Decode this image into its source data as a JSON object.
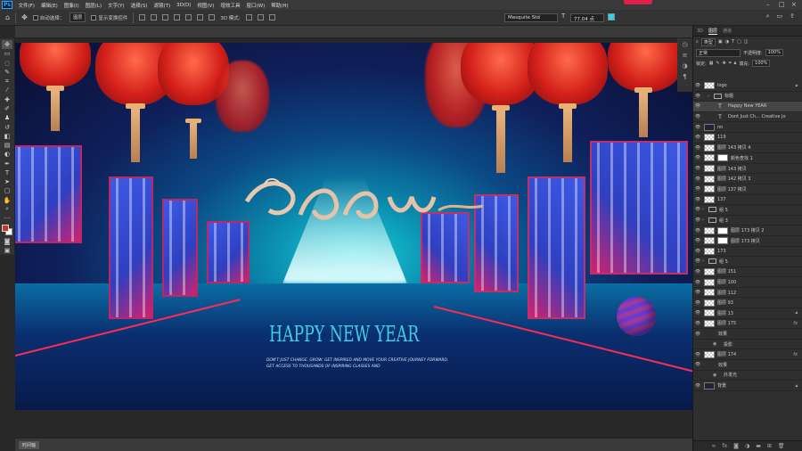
{
  "menubar": {
    "items": [
      "文件(F)",
      "编辑(E)",
      "图像(I)",
      "图层(L)",
      "文字(Y)",
      "选择(S)",
      "滤镜(T)",
      "3D(D)",
      "视图(V)",
      "增效工具",
      "窗口(W)",
      "帮助(H)"
    ],
    "logo": "Ps"
  },
  "options": {
    "auto_select_label": "自动选择：",
    "auto_select_value": "图层",
    "show_transform_label": "显示变换控件",
    "mode_label": "3D 模式:",
    "font": "Mesquite Std",
    "size": "77.04 点",
    "text_color": "#2ad4e0"
  },
  "canvas": {
    "headline": "HAPPY NEW YEAR",
    "subtitle_line1": "DON'T JUST CHANGE. GROW. GET INSPIRED AND MOVE YOUR CREATIVE JOURNEY FORWARD.",
    "subtitle_line2": "GET ACCESS TO THOUSANDS OF INSPIRING CLASSES AND"
  },
  "panels": {
    "tabs": [
      "3D",
      "图层",
      "通道"
    ],
    "kind_label": "类型",
    "blend_mode": "正常",
    "opacity_label": "不透明度:",
    "opacity": "100%",
    "lock_label": "锁定:",
    "fill_label": "填充:",
    "fill": "100%"
  },
  "layers": [
    {
      "name": "logo",
      "type": "img",
      "lock": true
    },
    {
      "name": "标题",
      "type": "group",
      "indent": 1
    },
    {
      "name": "Happy New YEAR",
      "type": "text",
      "indent": 2,
      "selected": true
    },
    {
      "name": "Dont Just Ch... Creative Jo",
      "type": "text",
      "indent": 2
    },
    {
      "name": "nn",
      "type": "dark"
    },
    {
      "name": "119",
      "type": "img"
    },
    {
      "name": "图层 143 拷贝 4",
      "type": "img"
    },
    {
      "name": "颜色查找 1",
      "type": "adj"
    },
    {
      "name": "图层 143 拷贝",
      "type": "img"
    },
    {
      "name": "图层 142 拷贝 3",
      "type": "img"
    },
    {
      "name": "图层 137 拷贝",
      "type": "img"
    },
    {
      "name": "137",
      "type": "img"
    },
    {
      "name": "组 5",
      "type": "group"
    },
    {
      "name": "组 3",
      "type": "group"
    },
    {
      "name": "图层 173 拷贝 2",
      "type": "masked"
    },
    {
      "name": "图层 173 拷贝",
      "type": "masked"
    },
    {
      "name": "173",
      "type": "img"
    },
    {
      "name": "组 5",
      "type": "group"
    },
    {
      "name": "图层 151",
      "type": "img"
    },
    {
      "name": "图层 100",
      "type": "img"
    },
    {
      "name": "图层 112",
      "type": "img"
    },
    {
      "name": "图层 93",
      "type": "img"
    },
    {
      "name": "图层 13",
      "type": "img",
      "lock": true
    },
    {
      "name": "图层 175",
      "type": "img",
      "fx": true
    },
    {
      "name": "效果",
      "type": "effect",
      "indent": 1
    },
    {
      "name": "投影",
      "type": "effect",
      "indent": 2
    },
    {
      "name": "图层 174",
      "type": "img",
      "fx": true
    },
    {
      "name": "效果",
      "type": "effect",
      "indent": 1
    },
    {
      "name": "外发光",
      "type": "effect",
      "indent": 2
    },
    {
      "name": "背景",
      "type": "dark",
      "lock": true
    }
  ],
  "status": {
    "timeline": "时间轴"
  }
}
